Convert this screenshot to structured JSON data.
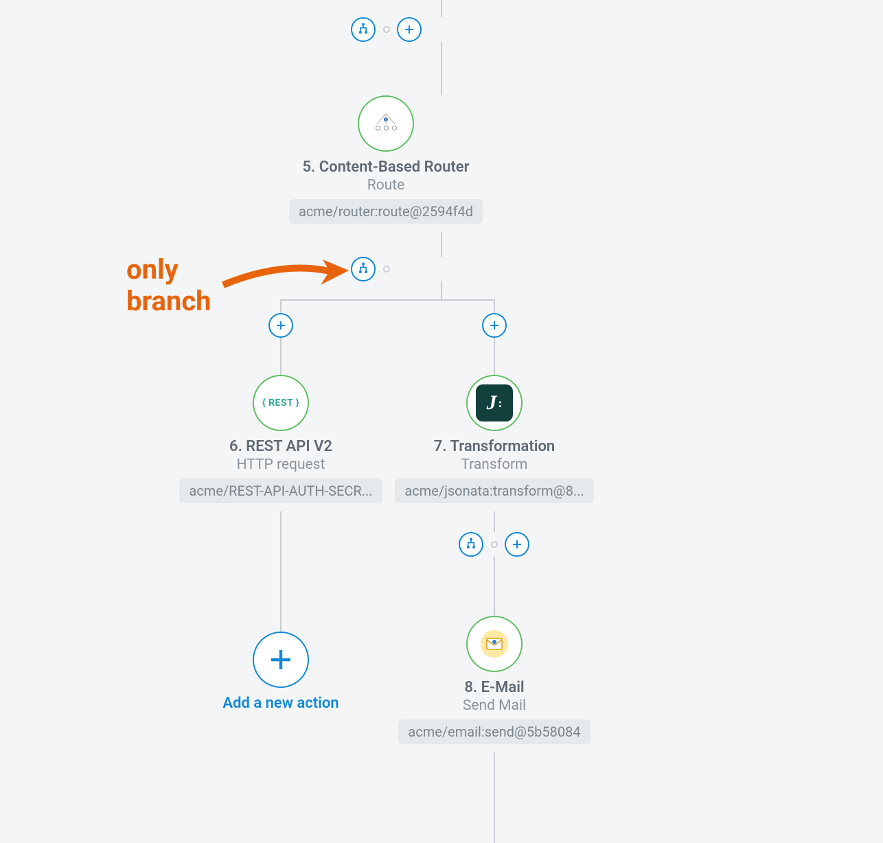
{
  "annotation": {
    "text_line1": "only",
    "text_line2": "branch"
  },
  "connectors": {
    "top": {
      "branch_button": "branch-icon",
      "add_button": "plus-icon"
    },
    "after_router": {
      "branch_button": "branch-icon"
    },
    "left_branch_add": "plus-icon",
    "right_branch_add": "plus-icon",
    "after_transform": {
      "branch_button": "branch-icon",
      "add_button": "plus-icon"
    }
  },
  "nodes": {
    "router": {
      "title": "5. Content-Based Router",
      "subtitle": "Route",
      "tag": "acme/router:route@2594f4d",
      "icon": "router-icon"
    },
    "rest": {
      "title": "6. REST API V2",
      "subtitle": "HTTP request",
      "tag": "acme/REST-API-AUTH-SECR...",
      "icon": "rest-icon",
      "icon_label": "REST"
    },
    "transform": {
      "title": "7. Transformation",
      "subtitle": "Transform",
      "tag": "acme/jsonata:transform@8...",
      "icon": "jsonata-icon"
    },
    "email": {
      "title": "8. E-Mail",
      "subtitle": "Send Mail",
      "tag": "acme/email:send@5b58084",
      "icon": "email-icon"
    }
  },
  "add_action": {
    "label": "Add a new action"
  },
  "colors": {
    "accent_blue": "#1089d6",
    "accent_green": "#5fbf63",
    "annotation_orange": "#e8640c",
    "text_primary": "#5f6a74",
    "text_secondary": "#8b949c",
    "tag_bg": "#e6e9eb",
    "connector": "#c7ccd1"
  }
}
